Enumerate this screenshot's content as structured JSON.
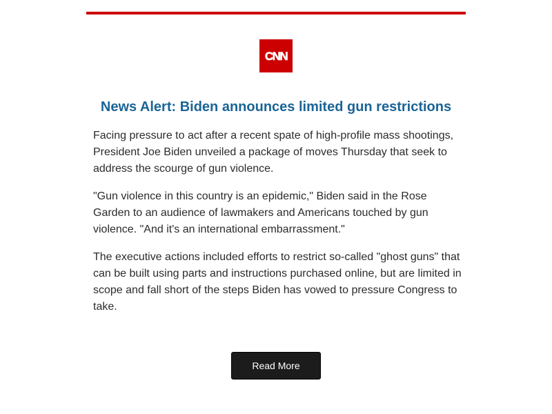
{
  "brand": {
    "logo_text": "CNN",
    "accent_color": "#cc0000"
  },
  "headline": "News Alert: Biden announces limited gun restrictions",
  "paragraphs": [
    "Facing pressure to act after a recent spate of high-profile mass shootings, President Joe Biden unveiled a package of moves Thursday that seek to address the scourge of gun violence.",
    "\"Gun violence in this country is an epidemic,\" Biden said in the Rose Garden to an audience of lawmakers and Americans touched by gun violence. \"And it's an international embarrassment.\"",
    "The executive actions included efforts to restrict so-called \"ghost guns\" that can be built using parts and instructions purchased online, but are limited in scope and fall short of the steps Biden has vowed to pressure Congress to take."
  ],
  "cta": {
    "label": "Read More"
  }
}
